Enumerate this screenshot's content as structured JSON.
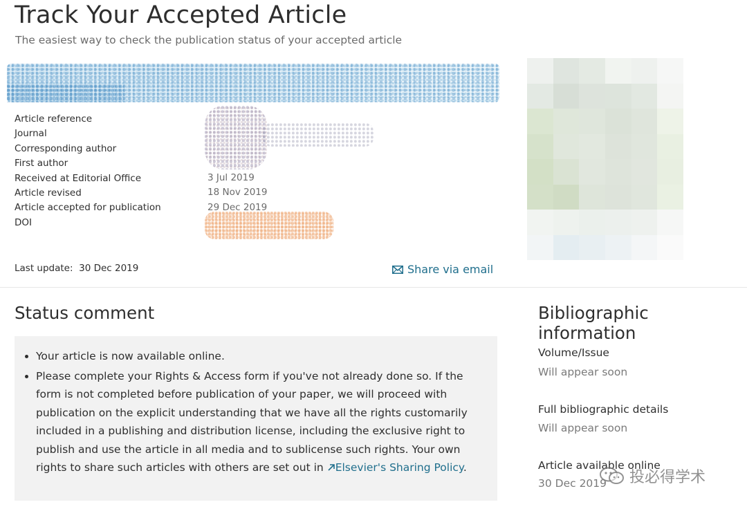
{
  "header": {
    "title": "Track Your Accepted Article",
    "subtitle": "The easiest way to check the publication status of your accepted article"
  },
  "article_meta": {
    "labels": [
      "Article reference",
      "Journal",
      "Corresponding author",
      "First author",
      "Received at Editorial Office",
      "Article revised",
      "Article accepted for publication",
      "DOI"
    ],
    "received": "3 Jul 2019",
    "revised": "18 Nov 2019",
    "accepted": "29 Dec 2019"
  },
  "last_update": {
    "label": "Last update:",
    "value": "30 Dec 2019"
  },
  "share": {
    "label": "Share via email",
    "icon": "envelope-icon"
  },
  "status_comment": {
    "heading": "Status comment",
    "items": [
      "Your article is now available online.",
      "Please complete your Rights & Access form if you've not already done so. If the form is not completed before publication of your paper, we will proceed with publication on the explicit understanding that we have all the rights customarily included in a publishing and distribution license, including the exclusive right to publish and use the article in all media and to sublicense such rights. Your own rights to share such articles with others are set out in"
    ],
    "link_label": "Elsevier's Sharing Policy",
    "link_icon": "external-link-arrow-icon",
    "link_suffix": "."
  },
  "bibliographic": {
    "heading": "Bibliographic information",
    "volume_issue_label": "Volume/Issue",
    "volume_issue_value": "Will appear soon",
    "full_details_label": "Full bibliographic details",
    "full_details_value": "Will appear soon",
    "available_online_label": "Article available online",
    "available_online_value": "30 Dec 2019"
  },
  "watermark": {
    "text": "投必得学术",
    "icon": "wechat-icon"
  },
  "colors": {
    "text": "#2e2e2e",
    "muted": "#6b6b6b",
    "link": "#1f6e8c",
    "status_bg": "#f2f2f2",
    "doi_blur": "#e8833a",
    "title_blur": "#2f7dba"
  }
}
